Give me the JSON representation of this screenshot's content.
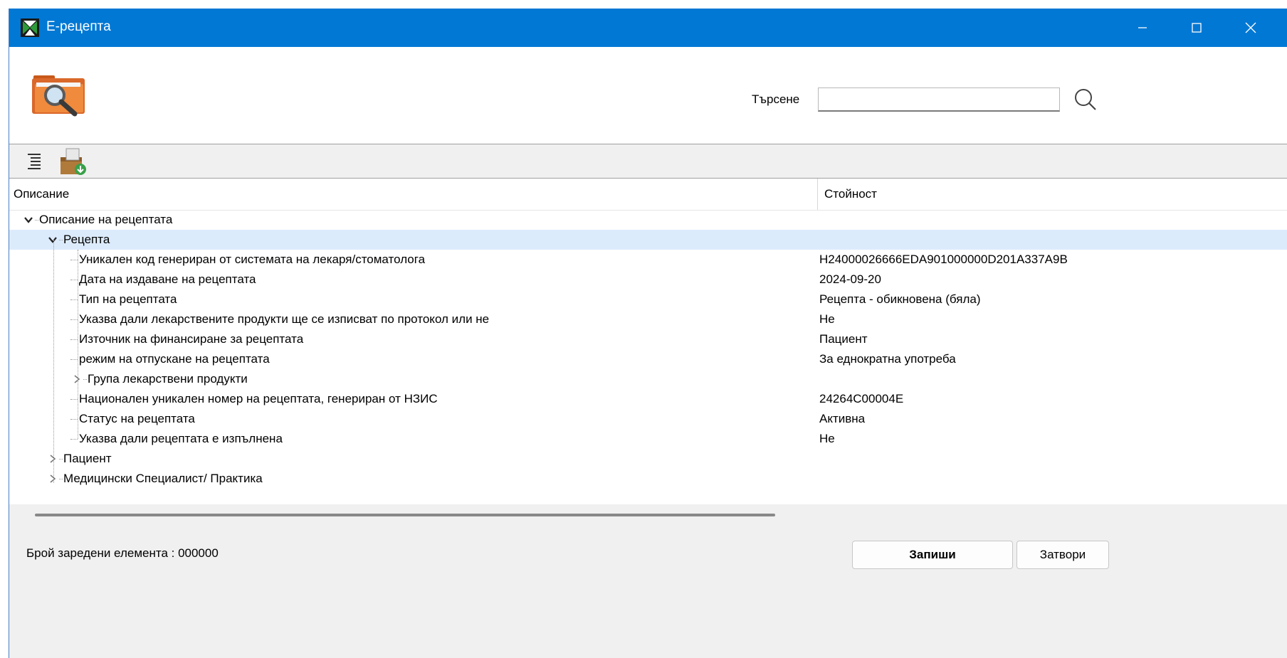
{
  "window": {
    "title": "Е-рецепта",
    "accent_color": "#0078d4"
  },
  "header": {
    "search_label": "Търсене",
    "search_value": "",
    "search_icon": "magnifier-icon",
    "folder_icon": "folder-search-icon"
  },
  "toolbar": {
    "expand_icon": "expand-all-icon",
    "export_icon": "export-package-icon"
  },
  "grid": {
    "columns": [
      "Описание",
      "Стойност"
    ],
    "rows": [
      {
        "label": "Описание на рецептата",
        "value": "",
        "level": 0,
        "state": "expanded"
      },
      {
        "label": "Рецепта",
        "value": "",
        "level": 1,
        "state": "expanded",
        "selected": true
      },
      {
        "label": "Уникален код генериран от системата на лекаря/стоматолога",
        "value": "H24000026666EDA901000000D201A337A9B",
        "level": 2,
        "state": "leaf"
      },
      {
        "label": "Дата на издаване на рецептата",
        "value": "2024-09-20",
        "level": 2,
        "state": "leaf"
      },
      {
        "label": "Тип на рецептата",
        "value": "Рецепта - обикновена (бяла)",
        "level": 2,
        "state": "leaf"
      },
      {
        "label": "Указва дали лекарствените продукти ще се изписват по протокол или не",
        "value": "Не",
        "level": 2,
        "state": "leaf"
      },
      {
        "label": "Източник на финансиране за рецептата",
        "value": "Пациент",
        "level": 2,
        "state": "leaf"
      },
      {
        "label": "режим на отпускане на рецептата",
        "value": "За еднократна употреба",
        "level": 2,
        "state": "leaf"
      },
      {
        "label": "Група лекарствени продукти",
        "value": "",
        "level": 2,
        "state": "collapsed"
      },
      {
        "label": "Национален уникален номер на рецептата, генериран от НЗИС",
        "value": "24264C00004E",
        "level": 2,
        "state": "leaf"
      },
      {
        "label": "Статус на рецептата",
        "value": "Активна",
        "level": 2,
        "state": "leaf"
      },
      {
        "label": "Указва дали рецептата е изпълнена",
        "value": "Не",
        "level": 2,
        "state": "leaf"
      },
      {
        "label": "Пациент",
        "value": "",
        "level": 1,
        "state": "collapsed"
      },
      {
        "label": "Медицински Специалист/ Практика",
        "value": "",
        "level": 1,
        "state": "collapsed"
      }
    ]
  },
  "status": {
    "count_text": "Брой заредени елемента : 000000",
    "save_label": "Запиши",
    "cancel_label": "Затвори"
  }
}
